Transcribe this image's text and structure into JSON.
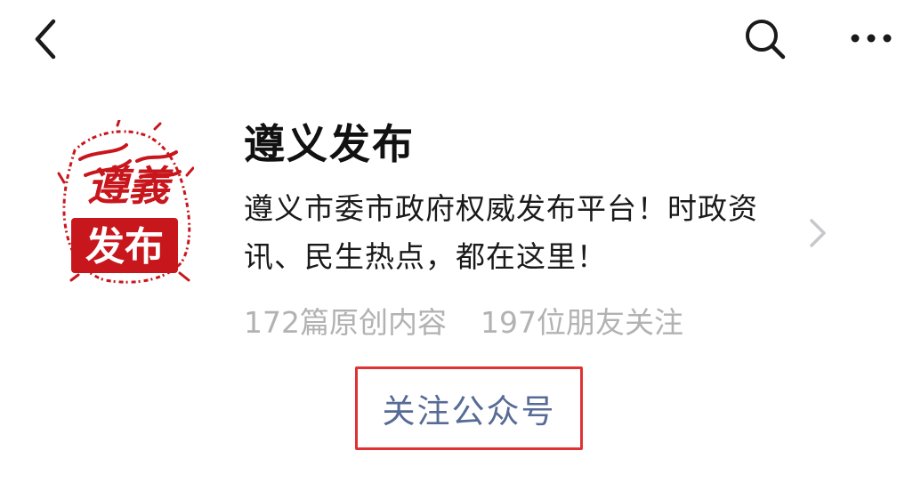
{
  "nav": {
    "back_icon": "chevron-left-icon",
    "search_icon": "search-icon",
    "more_icon": "more-horizontal-icon"
  },
  "profile": {
    "logo_icon": "zunyi-fabu-seal-logo",
    "logo_text_top": "遵義",
    "logo_text_bottom": "发布",
    "name": "遵义发布",
    "description": "遵义市委市政府权威发布平台！时政资讯、民生热点，都在这里！",
    "original_count": "172",
    "original_label": "篇原创内容",
    "followers_count": "197",
    "followers_label": "位朋友关注",
    "chevron_icon": "chevron-right-icon"
  },
  "actions": {
    "follow_label": "关注公众号"
  },
  "colors": {
    "background": "#ffffff",
    "link_blue": "#576b95",
    "muted_gray": "#b2b2b2",
    "logo_red": "#c8161d",
    "highlight_red": "#e03232"
  }
}
